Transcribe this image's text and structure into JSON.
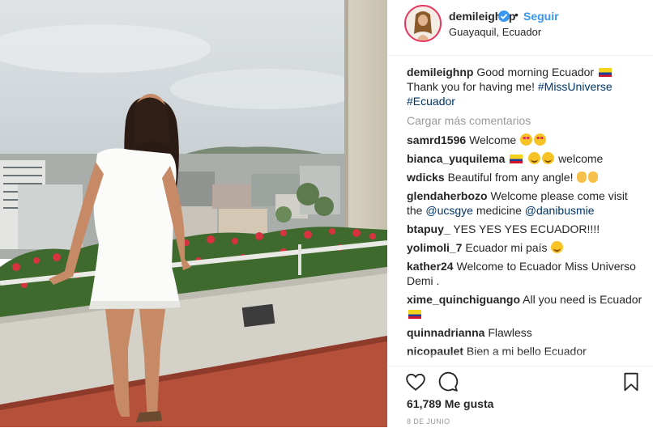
{
  "post": {
    "username": "demileighnp",
    "separator": "•",
    "follow_label": "Seguir",
    "location": "Guayaquil, Ecuador"
  },
  "caption": {
    "username": "demileighnp",
    "text_a": "Good morning Ecuador",
    "text_b": "Thank you for having me!",
    "hashtag1": "#MissUniverse",
    "hashtag2": "#Ecuador"
  },
  "load_more": "Cargar más comentarios",
  "comments": [
    {
      "user": "samrd1596",
      "text": "Welcome"
    },
    {
      "user": "bianca_yuquilema",
      "text": "welcome"
    },
    {
      "user": "wdicks",
      "text": "Beautiful from any angle!"
    },
    {
      "user": "glendaherbozo",
      "text_a": "Welcome please come visit the",
      "mention1": "@ucsgye",
      "text_b": "medicine",
      "mention2": "@danibusmie"
    },
    {
      "user": "btapuy_",
      "text": "YES YES YES ECUADOR!!!!"
    },
    {
      "user": "yolimoli_7",
      "text": "Ecuador mi país"
    },
    {
      "user": "kather24",
      "text": "Welcome to Ecuador Miss Universo Demi ."
    },
    {
      "user": "xime_quinchiguango",
      "text": "All you need is Ecuador"
    },
    {
      "user": "quinnadrianna",
      "text": "Flawless"
    },
    {
      "user": "nicopaulet",
      "text": "Bien a mi bello Ecuador"
    }
  ],
  "likes": "61,789 Me gusta",
  "date": "8 DE JUNIO",
  "icons": {
    "verified": "verified-badge-icon",
    "like": "heart-outline-icon",
    "comment": "comment-bubble-icon",
    "save": "bookmark-icon"
  },
  "colors": {
    "link": "#3897f0",
    "hashtag": "#003569",
    "muted": "#999999",
    "avatar_ring": "#e6345f"
  }
}
